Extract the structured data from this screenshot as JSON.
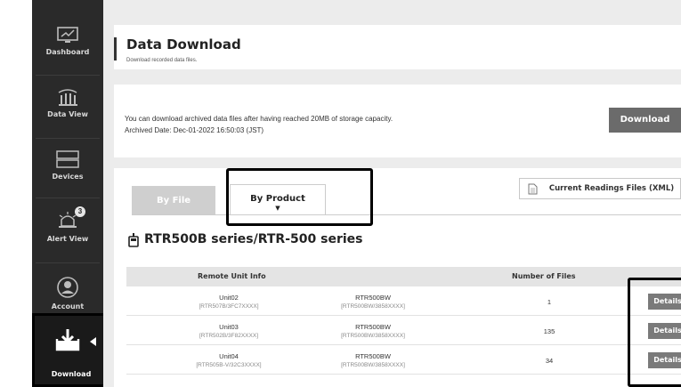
{
  "sidebar": {
    "items": [
      {
        "label": "Dashboard",
        "icon": "dashboard-icon"
      },
      {
        "label": "Data View",
        "icon": "data-view-icon"
      },
      {
        "label": "Devices",
        "icon": "devices-icon"
      },
      {
        "label": "Alert View",
        "icon": "alert-icon",
        "badge": "3"
      },
      {
        "label": "Account",
        "icon": "account-icon"
      },
      {
        "label": "Download",
        "icon": "download-icon",
        "active": true
      }
    ]
  },
  "header": {
    "title": "Data Download",
    "subtitle": "Download recorded data files."
  },
  "archive": {
    "line1": "You can download archived data files after having reached 20MB of storage capacity.",
    "line2": "Archived Date: Dec-01-2022 16:50:03 (JST)",
    "button": "Download"
  },
  "tabs": {
    "by_file": "By File",
    "by_product": "By Product",
    "caret": "▼"
  },
  "current_readings_button": "Current Readings Files (XML)",
  "series": {
    "title": "RTR500B series/RTR-500 series",
    "columns": {
      "remote_unit": "Remote Unit Info",
      "number_of_files": "Number of Files"
    },
    "rows": [
      {
        "unit": "Unit02",
        "unit_sub": "[RTR507B/3FC7XXXX]",
        "model": "RTR500BW",
        "model_sub": "[RTR500BW/3858XXXX]",
        "files": "1",
        "action": "Details"
      },
      {
        "unit": "Unit03",
        "unit_sub": "[RTR502B/3F82XXXX]",
        "model": "RTR500BW",
        "model_sub": "[RTR500BW/3858XXXX]",
        "files": "135",
        "action": "Details"
      },
      {
        "unit": "Unit04",
        "unit_sub": "[RTR505B-V/32C3XXXX]",
        "model": "RTR500BW",
        "model_sub": "[RTR500BW/3858XXXX]",
        "files": "34",
        "action": "Details"
      }
    ]
  },
  "colors": {
    "sidebar_bg": "#2a2a2a",
    "main_bg": "#ececec",
    "button_gray": "#6b6b6b",
    "highlight_border": "#000000"
  }
}
